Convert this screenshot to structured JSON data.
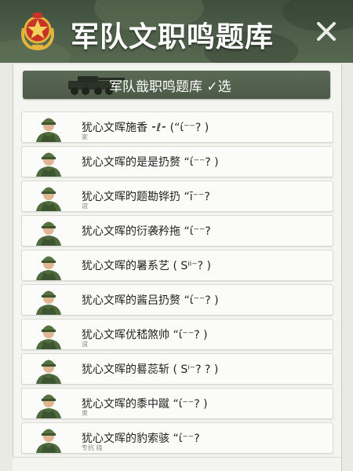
{
  "header": {
    "title": "军队文职鸣题库",
    "emblem_icon": "army-star-emblem-icon",
    "close_icon": "close-icon"
  },
  "banner": {
    "text": "军队戠职鸣题库 ✓选",
    "icon": "armored-vehicle-icon"
  },
  "items": [
    {
      "title": "犹心文晖施香 ⁃ℓ⁃ (“ί⁻⁻? )",
      "sub": "家"
    },
    {
      "title": "犹心文晖的是是扔赘 “ί⁻⁻? )",
      "sub": ""
    },
    {
      "title": "犹心文晖旳题勘铧扔 “ī⁻⁻?",
      "sub": "谊"
    },
    {
      "title": "犹心文晖的衍袭矜拖 “ί⁻⁻?",
      "sub": ""
    },
    {
      "title": "犹心文晖的暑系艺 ( Sⁱⁱ⁻? )",
      "sub": ""
    },
    {
      "title": "犹心文晖的酱吕扔赘 “ί⁻⁻? )",
      "sub": ""
    },
    {
      "title": "犹心文晖优嵇煞帅 “ί⁻⁻? )",
      "sub": "谊"
    },
    {
      "title": "犹心文晖的晷蕊斩 ( Sⁱ⁻? ? )",
      "sub": ""
    },
    {
      "title": "犹心文晖的黍中蹴 “ί⁻⁻? )",
      "sub": "束"
    },
    {
      "title": "犹心文晖的豹索骇 “ί⁻⁻?",
      "sub": "专抗 挠"
    }
  ],
  "colors": {
    "header_bg": "#4a5a46",
    "banner_bg": "#55644f",
    "page_bg": "#e9eae4",
    "item_bg": "#fbfbf9",
    "emblem_red": "#c8342a",
    "emblem_gold": "#e2b43c"
  }
}
